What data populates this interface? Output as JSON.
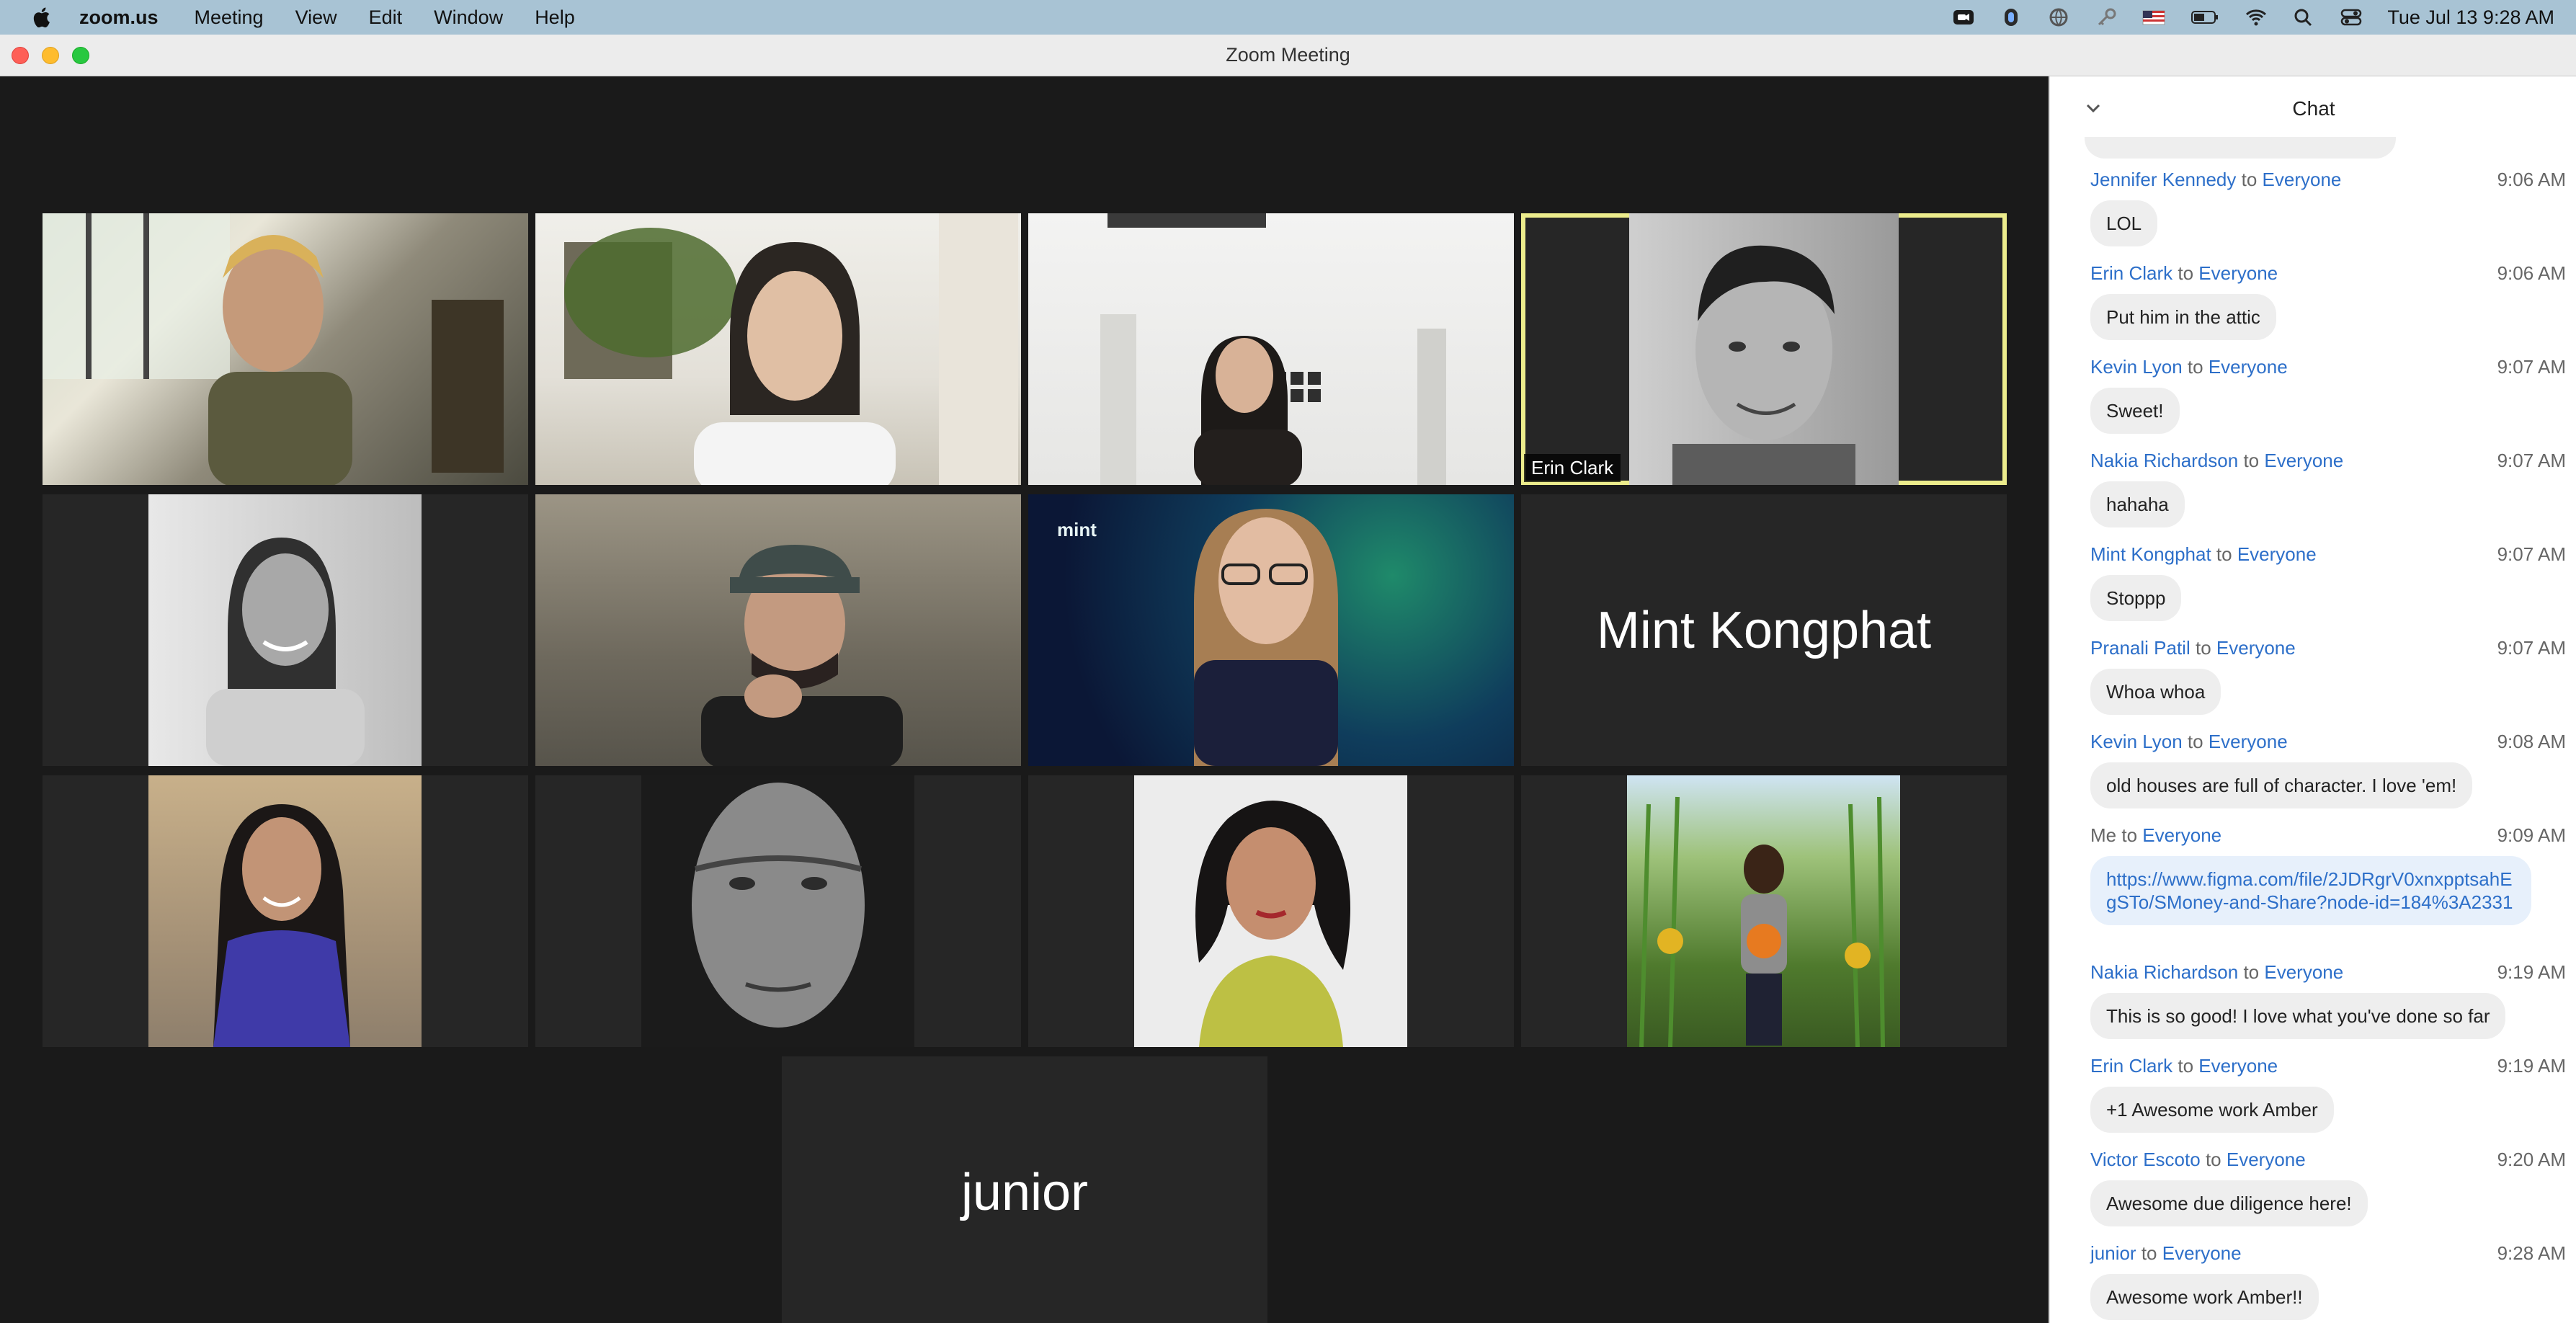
{
  "menubar": {
    "app_name": "zoom.us",
    "items": [
      "Meeting",
      "View",
      "Edit",
      "Window",
      "Help"
    ],
    "clock": "Tue Jul 13  9:28 AM"
  },
  "window": {
    "title": "Zoom Meeting"
  },
  "participants": {
    "active_speaker": "Erin Clark",
    "no_video_1": "Mint Kongphat",
    "no_video_2": "junior"
  },
  "chat": {
    "title": "Chat",
    "to_word": "to",
    "messages": [
      {
        "sender": "Jennifer Kennedy",
        "recipient": "Everyone",
        "time": "9:06 AM",
        "text": "LOL"
      },
      {
        "sender": "Erin Clark",
        "recipient": "Everyone",
        "time": "9:06 AM",
        "text": "Put him in the attic"
      },
      {
        "sender": "Kevin Lyon",
        "recipient": "Everyone",
        "time": "9:07 AM",
        "text": "Sweet!"
      },
      {
        "sender": "Nakia Richardson",
        "recipient": "Everyone",
        "time": "9:07 AM",
        "text": "hahaha"
      },
      {
        "sender": "Mint Kongphat",
        "recipient": "Everyone",
        "time": "9:07 AM",
        "text": "Stoppp"
      },
      {
        "sender": "Pranali Patil",
        "recipient": "Everyone",
        "time": "9:07 AM",
        "text": "Whoa whoa"
      },
      {
        "sender": "Kevin Lyon",
        "recipient": "Everyone",
        "time": "9:08 AM",
        "text": "old houses are full of character. I love 'em!"
      },
      {
        "sender": "Me",
        "recipient": "Everyone",
        "time": "9:09 AM",
        "text": "https://www.figma.com/file/2JDRgrV0xnxpptsahEgSTo/SMoney-and-Share?node-id=184%3A2331"
      },
      {
        "sender": "Nakia Richardson",
        "recipient": "Everyone",
        "time": "9:19 AM",
        "text": "This is so good! I love what you've done so far"
      },
      {
        "sender": "Erin Clark",
        "recipient": "Everyone",
        "time": "9:19 AM",
        "text": "+1 Awesome work Amber"
      },
      {
        "sender": "Victor Escoto",
        "recipient": "Everyone",
        "time": "9:20 AM",
        "text": "Awesome due diligence here!"
      },
      {
        "sender": "junior",
        "recipient": "Everyone",
        "time": "9:28 AM",
        "text": "Awesome work Amber!!"
      }
    ]
  },
  "colors": {
    "menubar": "#a8c3d4",
    "chat_link": "#2d6fc9",
    "active_outline": "#ecec8c",
    "tile_bg": "#262626"
  },
  "icons": [
    "apple-icon",
    "camera-icon",
    "battery-icon",
    "wifi-icon",
    "search-icon",
    "control-center-icon",
    "flag-icon",
    "chevron-down-icon"
  ]
}
